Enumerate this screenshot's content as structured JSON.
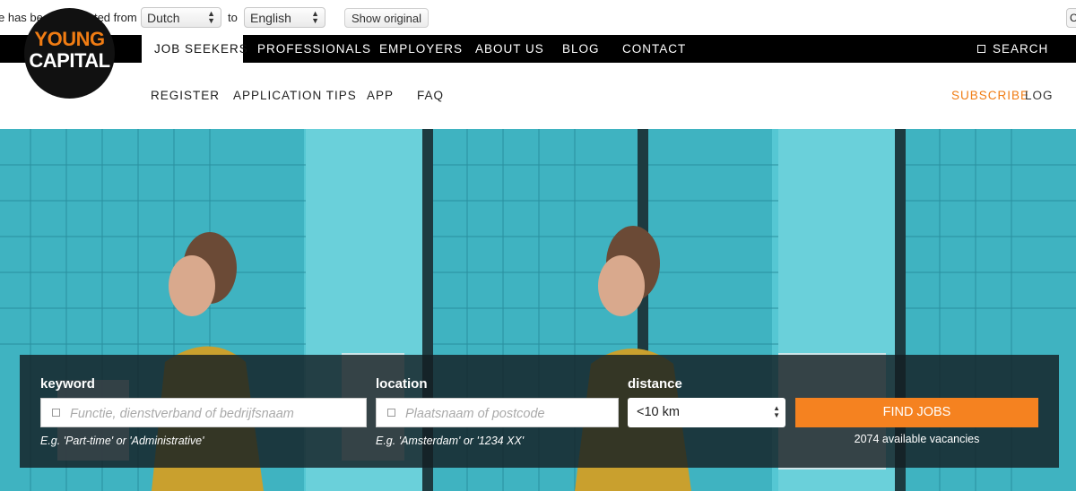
{
  "translate_bar": {
    "message": "e has been translated from",
    "from_lang": "Dutch",
    "to_word": "to",
    "to_lang": "English",
    "show_original": "Show original",
    "close": "C"
  },
  "top_nav": {
    "items": [
      "JOB SEEKERS",
      "PROFESSIONALS",
      "EMPLOYERS",
      "ABOUT US",
      "BLOG",
      "CONTACT"
    ],
    "search": "SEARCH"
  },
  "logo": {
    "line1": "YOUNG",
    "line2": "CAPITAL"
  },
  "sub_nav": {
    "items": [
      "REGISTER",
      "APPLICATION TIPS",
      "APP",
      "FAQ"
    ],
    "subscribe": "SUBSCRIBE",
    "log": "LOG"
  },
  "search": {
    "keyword_label": "keyword",
    "keyword_placeholder": "Functie, dienstverband of bedrijfsnaam",
    "keyword_hint": "E.g. 'Part-time' or 'Administrative'",
    "location_label": "location",
    "location_placeholder": "Plaatsnaam of postcode",
    "location_hint": "E.g. 'Amsterdam' or '1234 XX'",
    "distance_label": "distance",
    "distance_value": "<10 km",
    "find_button": "FIND JOBS",
    "vacancies": "2074 available vacancies"
  },
  "colors": {
    "accent": "#f58220",
    "nav_bg": "#000000",
    "hero_bg": "#4fc6d2"
  }
}
